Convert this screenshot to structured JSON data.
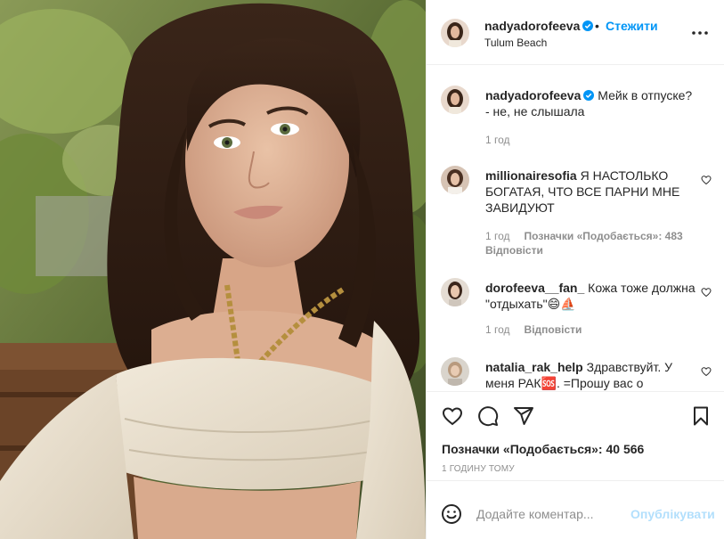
{
  "photo": {
    "alt": ""
  },
  "header": {
    "username": "nadyadorofeeva",
    "dot": "•",
    "follow_label": "Стежити",
    "location": "Tulum Beach",
    "more_icon": "more-horizontal-icon"
  },
  "caption": {
    "username": "nadyadorofeeva",
    "text_line1": "Мейк в отпуске?",
    "text_line2": "- не, не слышала",
    "time": "1 год"
  },
  "comments": [
    {
      "username": "millionairesofia",
      "text": "Я НАСТОЛЬКО БОГАТАЯ, ЧТО ВСЕ ПАРНИ МНЕ ЗАВИДУЮТ",
      "time": "1 год",
      "likes": "Позначки «Подобається»: 483",
      "reply": "Відповісти"
    },
    {
      "username": "dorofeeva__fan_",
      "text": "Кожа тоже должна \"отдыхать\"😄⛵",
      "time": "1 год",
      "reply": "Відповісти"
    },
    {
      "username": "natalia_rak_help",
      "text": "Здравствуйт. У меня РАК🆘. =Прошу вас о"
    }
  ],
  "actions": {
    "like_icon": "heart-outline-icon",
    "comment_icon": "comment-icon",
    "share_icon": "send-icon",
    "save_icon": "bookmark-icon",
    "likes_text": "Позначки «Подобається»: 40 566",
    "time_ago": "1 ГОДИНУ ТОМУ"
  },
  "add_comment": {
    "placeholder": "Додайте коментар...",
    "post_label": "Опублікувати",
    "emoji_icon": "smile-icon"
  },
  "colors": {
    "accent": "#0095f6",
    "post_disabled": "#b2dffc",
    "secondary_text": "#8e8e8e",
    "border": "#efefef"
  }
}
